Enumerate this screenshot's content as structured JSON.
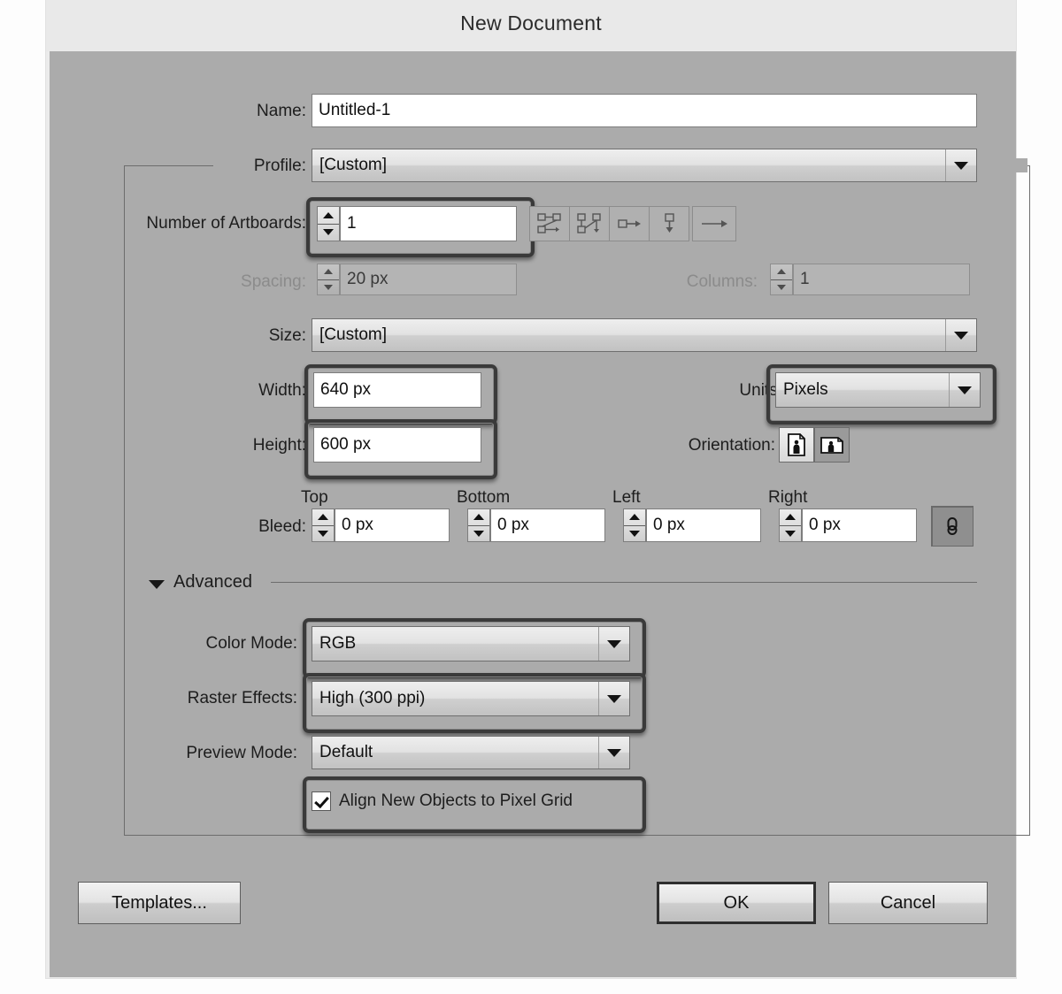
{
  "dialog": {
    "title": "New Document"
  },
  "fields": {
    "name": {
      "label": "Name:",
      "value": "Untitled-1"
    },
    "profile": {
      "label": "Profile:",
      "value": "[Custom]"
    },
    "artboards": {
      "label": "Number of Artboards:",
      "value": "1"
    },
    "spacing": {
      "label": "Spacing:",
      "value": "20 px"
    },
    "columns": {
      "label": "Columns:",
      "value": "1"
    },
    "size": {
      "label": "Size:",
      "value": "[Custom]"
    },
    "width": {
      "label": "Width:",
      "value": "640 px"
    },
    "height": {
      "label": "Height:",
      "value": "600 px"
    },
    "units": {
      "label": "Units:",
      "value": "Pixels"
    },
    "orientation": {
      "label": "Orientation:"
    },
    "bleed": {
      "label": "Bleed:",
      "top": {
        "label": "Top",
        "value": "0 px"
      },
      "bottom": {
        "label": "Bottom",
        "value": "0 px"
      },
      "left": {
        "label": "Left",
        "value": "0 px"
      },
      "right": {
        "label": "Right",
        "value": "0 px"
      }
    }
  },
  "advanced": {
    "label": "Advanced",
    "color_mode": {
      "label": "Color Mode:",
      "value": "RGB"
    },
    "raster_effects": {
      "label": "Raster Effects:",
      "value": "High (300 ppi)"
    },
    "preview_mode": {
      "label": "Preview Mode:",
      "value": "Default"
    },
    "align_pixel_grid": {
      "label": "Align New Objects to Pixel Grid",
      "checked": true
    }
  },
  "icons": {
    "artboard_layouts": [
      "grid-by-row-icon",
      "grid-by-column-icon",
      "arrange-by-row-icon",
      "arrange-by-column-icon"
    ],
    "artboard_direction": "right-to-left-arrow-icon",
    "orientation_portrait": "portrait-icon",
    "orientation_landscape": "landscape-icon",
    "bleed_link": "link-chain-icon",
    "advanced_disclosure": "triangle-down-icon",
    "dropdown_arrow": "chevron-down-icon",
    "spinner": "stepper-arrows-icon",
    "checkbox_check": "checkmark-icon"
  },
  "buttons": {
    "templates": "Templates...",
    "ok": "OK",
    "cancel": "Cancel"
  },
  "colors": {
    "dialog_body": "#ababab",
    "titlebar": "#e9e9e9",
    "input_bg": "#ffffff",
    "highlight_ring": "#3a3a3a",
    "disabled_text": "#8b8b8b"
  }
}
